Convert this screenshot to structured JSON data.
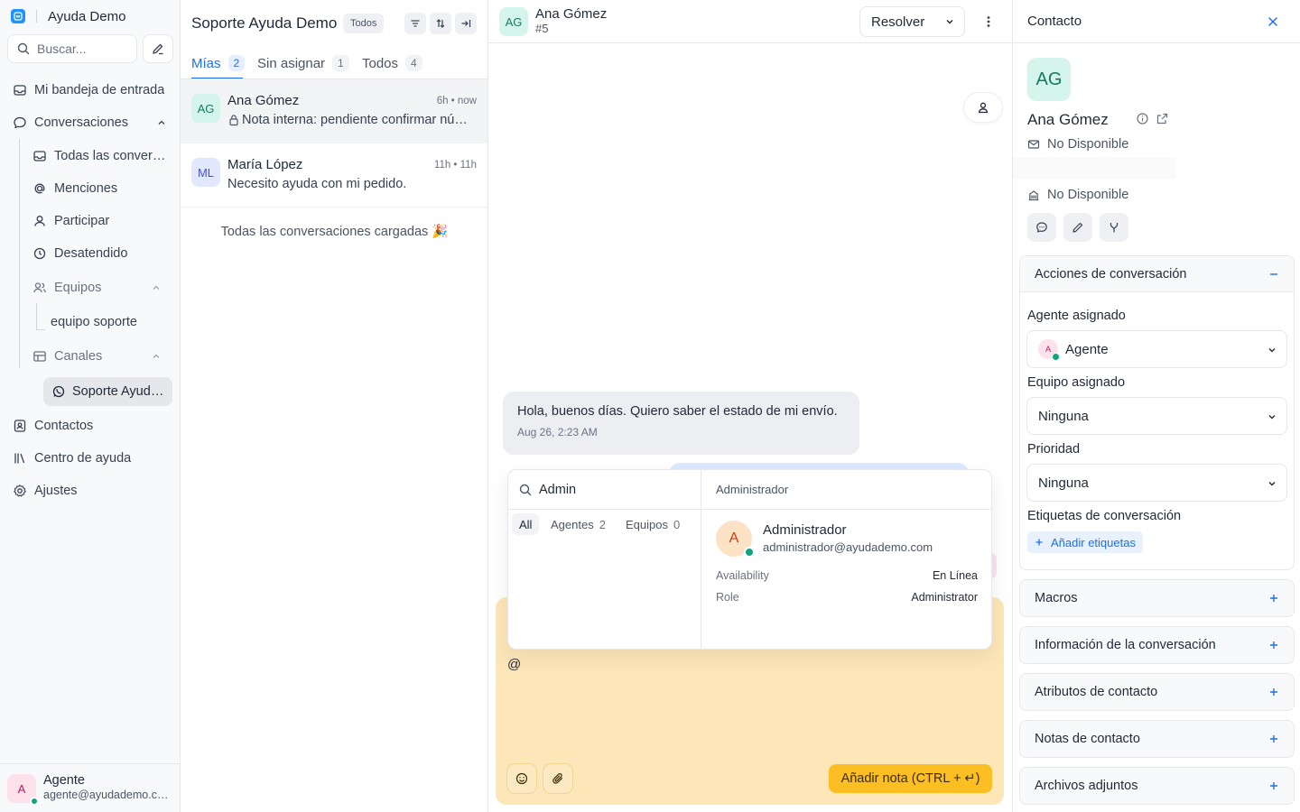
{
  "app": {
    "name": "Ayuda Demo"
  },
  "colors": {
    "accent": "#1f6fe5",
    "online": "#12a37f",
    "note_bg": "#fde7b9",
    "note_button": "#fbbf24"
  },
  "sidebar": {
    "search_placeholder": "Buscar...",
    "items": {
      "inbox": "Mi bandeja de entrada",
      "conversations": "Conversaciones",
      "all_conversations": "Todas las conversaciones",
      "mentions": "Menciones",
      "participate": "Participar",
      "unattended": "Desatendido",
      "teams": "Equipos",
      "team_support": "equipo soporte",
      "channels": "Canales",
      "channel_active": "Soporte Ayuda Demo",
      "contacts": "Contactos",
      "help_center": "Centro de ayuda",
      "settings": "Ajustes"
    },
    "user": {
      "initial": "A",
      "name": "Agente",
      "email": "agente@ayudademo.com"
    }
  },
  "conv_list": {
    "title": "Soporte Ayuda Demo",
    "filter_badge": "Todos",
    "tabs": [
      {
        "label": "Mías",
        "count": "2"
      },
      {
        "label": "Sin asignar",
        "count": "1"
      },
      {
        "label": "Todos",
        "count": "4"
      }
    ],
    "items": [
      {
        "initials": "AG",
        "name": "Ana Gómez",
        "time": "6h • now",
        "message": "Nota interna: pendiente confirmar número de seguimiento"
      },
      {
        "initials": "ML",
        "name": "María López",
        "time": "11h • 11h",
        "message": "Necesito ayuda con mi pedido."
      }
    ],
    "loaded_message": "Todas las conversaciones cargadas 🎉"
  },
  "chat": {
    "contact_initials": "AG",
    "contact_name": "Ana Gómez",
    "conversation_id": "#5",
    "resolve_label": "Resolver",
    "incoming": {
      "text": "Hola, buenos días. Quiero saber el estado de mi envío.",
      "timestamp": "Aug 26, 2:23 AM"
    },
    "composer_text": "@",
    "add_note_label": "Añadir nota (CTRL + ↵)"
  },
  "mention_popup": {
    "search_value": "Admin",
    "tabs": [
      {
        "label": "All",
        "count": ""
      },
      {
        "label": "Agentes",
        "count": "2"
      },
      {
        "label": "Equipos",
        "count": "0"
      }
    ],
    "section_title": "Administrador",
    "result": {
      "initial": "A",
      "name": "Administrador",
      "email": "administrador@ayudademo.com",
      "availability_label": "Availability",
      "availability_value": "En Línea",
      "role_label": "Role",
      "role_value": "Administrator"
    }
  },
  "contact_panel": {
    "title": "Contacto",
    "initials": "AG",
    "name": "Ana Gómez",
    "email": "No Disponible",
    "company": "No Disponible",
    "actions_section": "Acciones de conversación",
    "assigned_agent_label": "Agente asignado",
    "assigned_agent_initial": "A",
    "assigned_agent_value": "Agente",
    "assigned_team_label": "Equipo asignado",
    "assigned_team_value": "Ninguna",
    "priority_label": "Prioridad",
    "priority_value": "Ninguna",
    "tags_label": "Etiquetas de conversación",
    "add_tags_label": "Añadir etiquetas",
    "sections": [
      "Macros",
      "Información de la conversación",
      "Atributos de contacto",
      "Notas de contacto",
      "Archivos adjuntos"
    ]
  }
}
